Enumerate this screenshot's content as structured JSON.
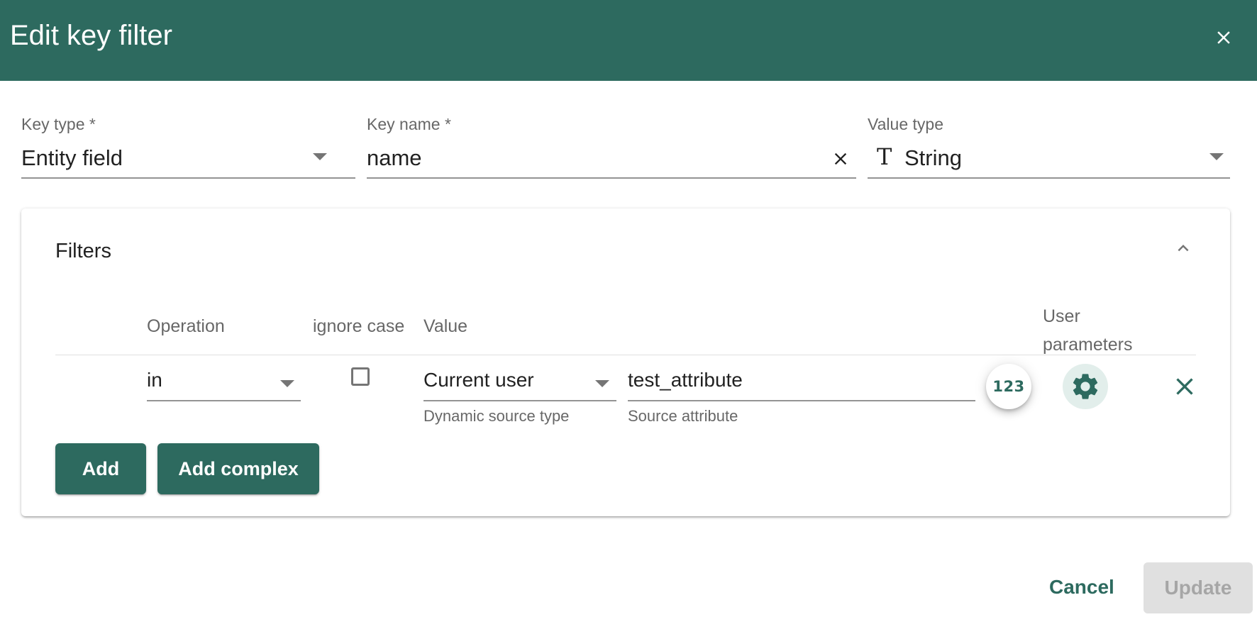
{
  "dialog": {
    "title": "Edit key filter"
  },
  "key_type": {
    "label": "Key type *",
    "value": "Entity field"
  },
  "key_name": {
    "label": "Key name *",
    "value": "name"
  },
  "value_type": {
    "label": "Value type",
    "icon_glyph": "T",
    "value": "String"
  },
  "filters": {
    "title": "Filters",
    "columns": {
      "operation": "Operation",
      "ignore_case": "ignore case",
      "value": "Value",
      "user_parameters_line1": "User",
      "user_parameters_line2": "parameters"
    },
    "row": {
      "operation": "in",
      "ignore_case_checked": false,
      "dynamic_source_type": "Current user",
      "dynamic_source_type_hint": "Dynamic source type",
      "source_attribute": "test_attribute",
      "source_attribute_hint": "Source attribute",
      "numeric_toggle_label": "123"
    },
    "add_label": "Add",
    "add_complex_label": "Add complex"
  },
  "actions": {
    "cancel_label": "Cancel",
    "update_label": "Update"
  },
  "colors": {
    "primary": "#2d6a5f",
    "header_bg": "#2d6a5f",
    "disabled_bg": "#e0e0e0"
  },
  "icons": {
    "close": "close-icon",
    "clear": "clear-icon",
    "dropdown": "arrow-drop-down-icon",
    "collapse": "chevron-up-icon",
    "text_type": "text-type-icon",
    "settings": "gear-icon",
    "remove": "close-icon"
  }
}
